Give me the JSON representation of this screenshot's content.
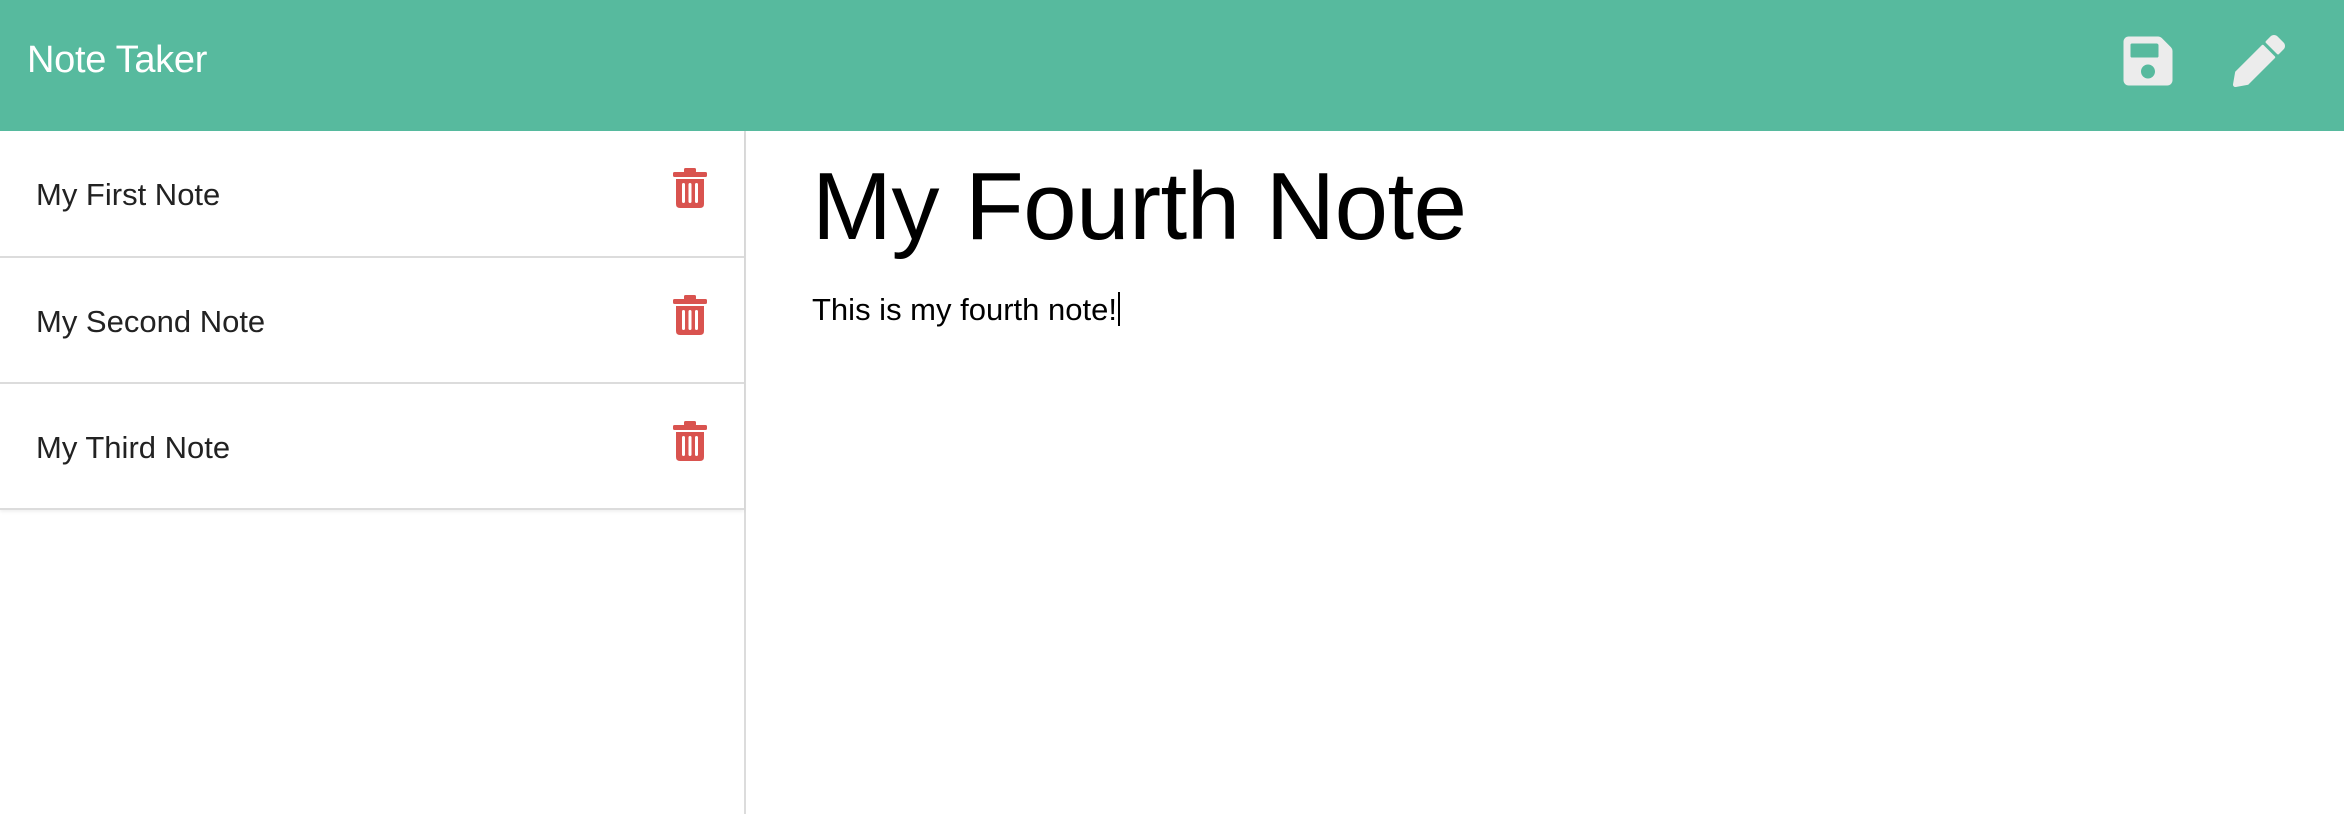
{
  "app": {
    "title": "Note Taker",
    "accent_color": "#57ba9e",
    "delete_color": "#d9534f"
  },
  "toolbar": {
    "save_icon": "floppy-disk-icon",
    "new_note_icon": "pencil-icon"
  },
  "sidebar": {
    "notes": [
      {
        "title": "My First Note",
        "delete_icon": "trash-icon"
      },
      {
        "title": "My Second Note",
        "delete_icon": "trash-icon"
      },
      {
        "title": "My Third Note",
        "delete_icon": "trash-icon"
      }
    ]
  },
  "editor": {
    "title": "My Fourth Note",
    "text": "This is my fourth note!"
  }
}
